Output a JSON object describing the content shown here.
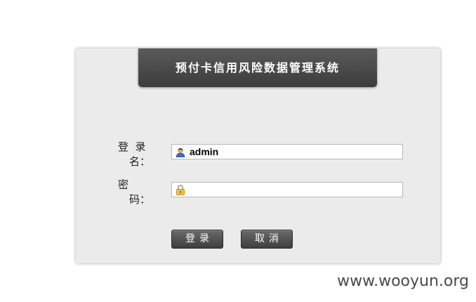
{
  "header": {
    "title": "预付卡信用风险数据管理系统"
  },
  "form": {
    "username_label_line1": "登  录",
    "username_label_line2": "名：",
    "username_icon": "user-icon",
    "username_value": "admin",
    "password_label_line1": "密",
    "password_label_line2": "码：",
    "password_icon": "lock-icon",
    "password_value": ""
  },
  "buttons": {
    "login_label": "登录",
    "cancel_label": "取消"
  },
  "watermark": "www.wooyun.org"
}
